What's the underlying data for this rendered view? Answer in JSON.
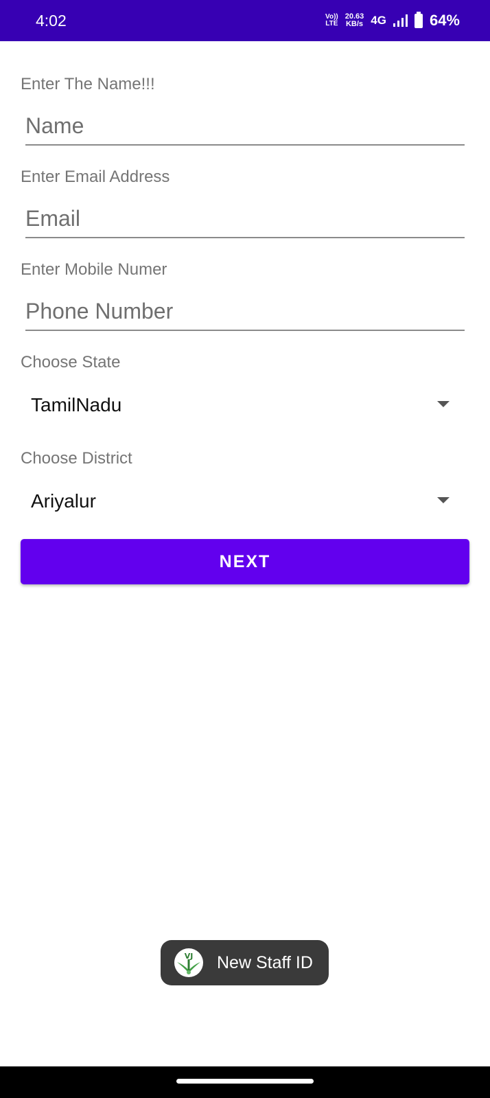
{
  "status_bar": {
    "time": "4:02",
    "volte_top": "Vo))",
    "volte_bottom": "LTE",
    "speed_value": "20.63",
    "speed_unit": "KB/s",
    "network": "4G",
    "battery": "64%"
  },
  "form": {
    "name_label": "Enter The Name!!!",
    "name_placeholder": "Name",
    "email_label": "Enter Email Address",
    "email_placeholder": "Email",
    "mobile_label": "Enter Mobile Numer",
    "mobile_placeholder": "Phone Number",
    "state_label": "Choose State",
    "state_selected": "TamilNadu",
    "district_label": "Choose District",
    "district_selected": "Ariyalur",
    "next_label": "NEXT"
  },
  "toast": {
    "text": "New Staff ID",
    "icon": "app-logo-icon",
    "icon_letters": "VJ"
  },
  "colors": {
    "status_bar": "#3700b3",
    "primary_button": "#6200ee",
    "toast_bg": "#3a3a3a"
  }
}
